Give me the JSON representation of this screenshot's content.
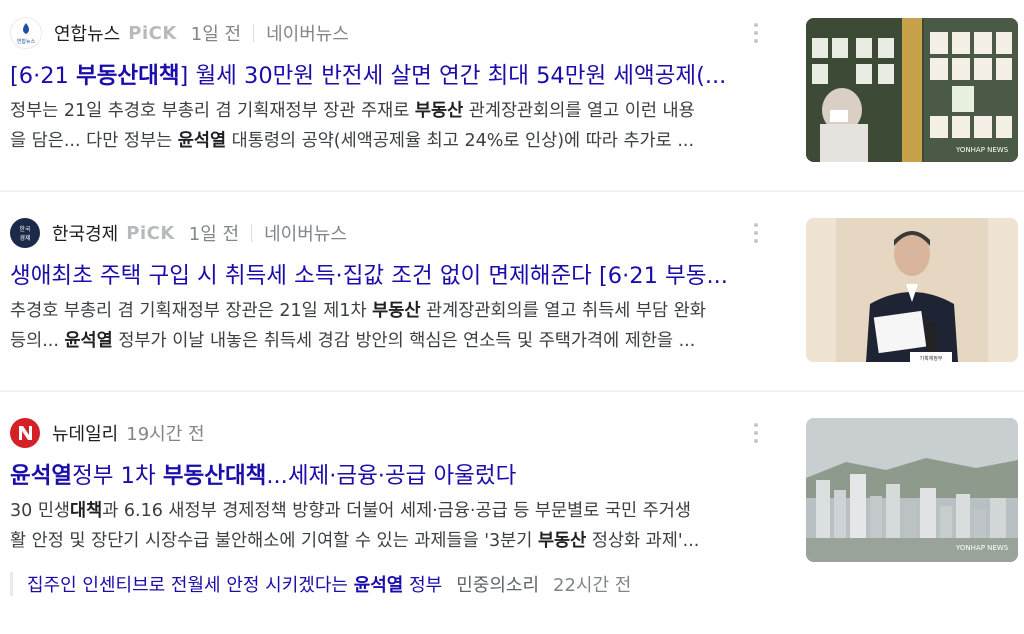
{
  "items": [
    {
      "press_name": "연합뉴스",
      "pick": "PiCK",
      "logo_text": "연합뉴스",
      "time": "1일 전",
      "source": "네이버뉴스",
      "title_parts": [
        "[6·21 ",
        "부동산대책",
        "] 월세 30만원 반전세 살면 연간 최대 54만원 세액공제(..."
      ],
      "desc_line1": [
        "정부는 21일 추경호 부총리 겸 기획재정부 장관 주재로 ",
        "부동산",
        " 관계장관회의를 열고 이런 내용"
      ],
      "desc_line2": [
        "을 담은... 다만 정부는 ",
        "윤석열",
        " 대통령의 공약(세액공제율 최고 24%로 인상)에 따라 추가로 ..."
      ],
      "thumb_watermark": "YONHAP NEWS"
    },
    {
      "press_name": "한국경제",
      "pick": "PiCK",
      "logo_text": "한국경제",
      "time": "1일 전",
      "source": "네이버뉴스",
      "title_parts": [
        "생애최초 주택 구입 시 취득세 소득·집값 조건 없이 면제해준다 [6·21 부동..."
      ],
      "desc_line1": [
        "추경호 부총리 겸 기획재정부 장관은 21일 제1차 ",
        "부동산",
        " 관계장관회의를 열고 취득세 부담 완화"
      ],
      "desc_line2": [
        "등의... ",
        "윤석열",
        " 정부가 이날 내놓은 취득세 경감 방안의 핵심은 연소득 및 주택가격에 제한을 ..."
      ],
      "thumb_sign": "기획재정부"
    },
    {
      "press_name": "뉴데일리",
      "time": "19시간 전",
      "title_parts": [
        "윤석열",
        "정부 1차 ",
        "부동산대책",
        "...세제·금융·공급 아울렀다"
      ],
      "desc_line1": [
        "30 민생",
        "대책",
        "과 6.16 새정부 경제정책 방향과 더불어 세제·금융·공급 등 부문별로 국민 주거생"
      ],
      "desc_line2": [
        "활 안정 및 장단기 시장수급 불안해소에 기여할 수 있는 과제들을 '3분기 ",
        "부동산",
        " 정상화 과제'..."
      ],
      "thumb_watermark": "YONHAP NEWS",
      "related": {
        "title_parts": [
          "집주인 인센티브로 전월세 안정 시키겠다는 ",
          "윤석열",
          " 정부"
        ],
        "press": "민중의소리",
        "time": "22시간 전"
      }
    }
  ],
  "colors": {
    "title": "#1a0dab",
    "meta": "#80868b",
    "pick": "#b7b9bd"
  }
}
